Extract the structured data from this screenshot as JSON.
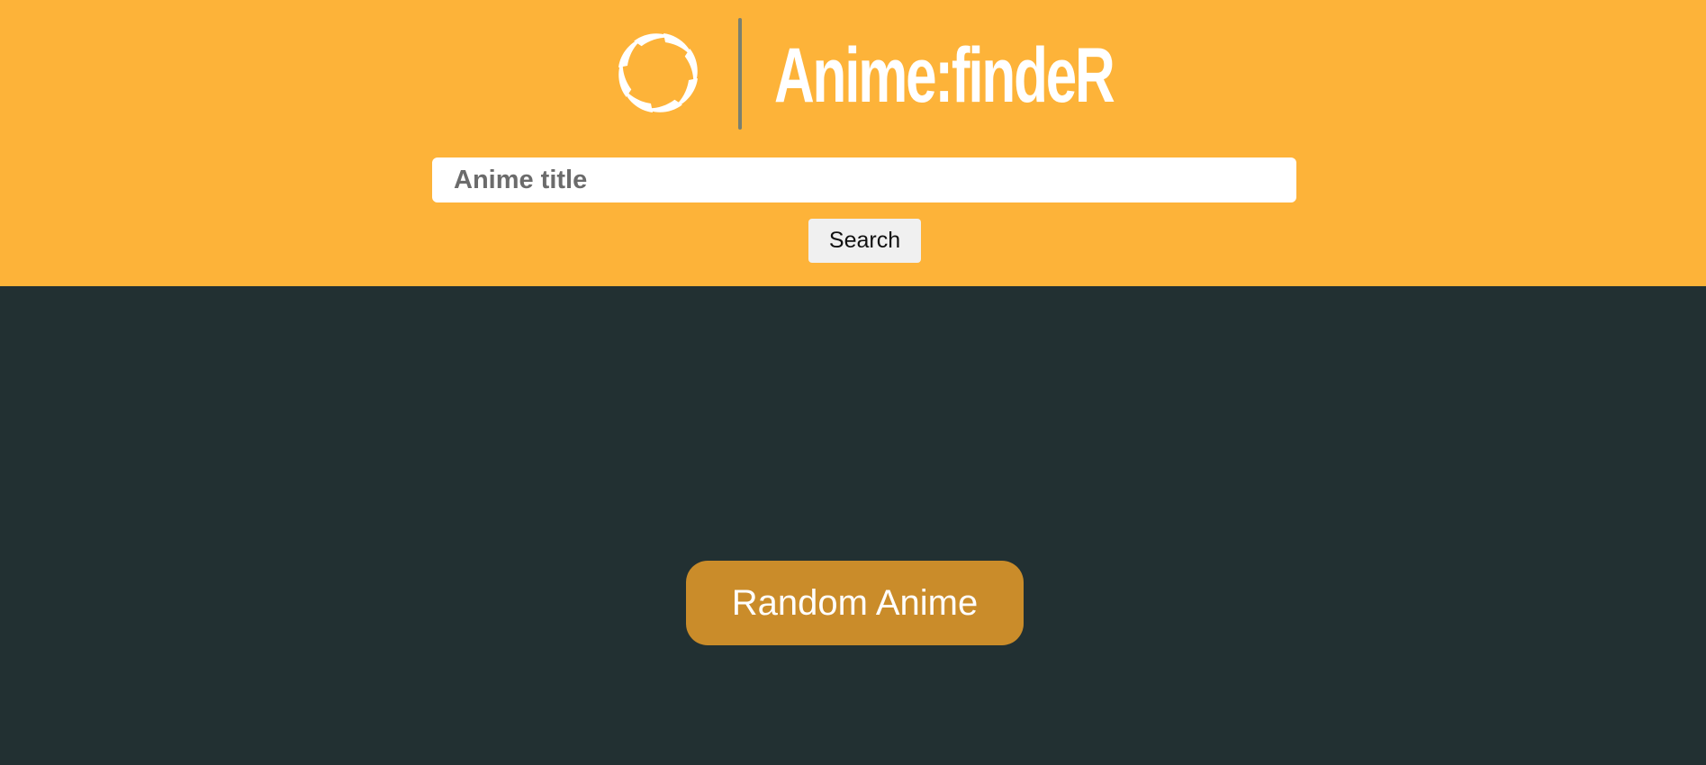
{
  "header": {
    "logo": {
      "icon": "swirl-logo-icon",
      "text": "Anime:findeR"
    },
    "search": {
      "placeholder": "Anime title",
      "value": "",
      "button_label": "Search"
    }
  },
  "main": {
    "random_button_label": "Random Anime"
  },
  "colors": {
    "header_bg": "#FDB339",
    "main_bg": "#223032",
    "random_button_bg": "#CA8C2A",
    "divider": "#7A8070"
  }
}
